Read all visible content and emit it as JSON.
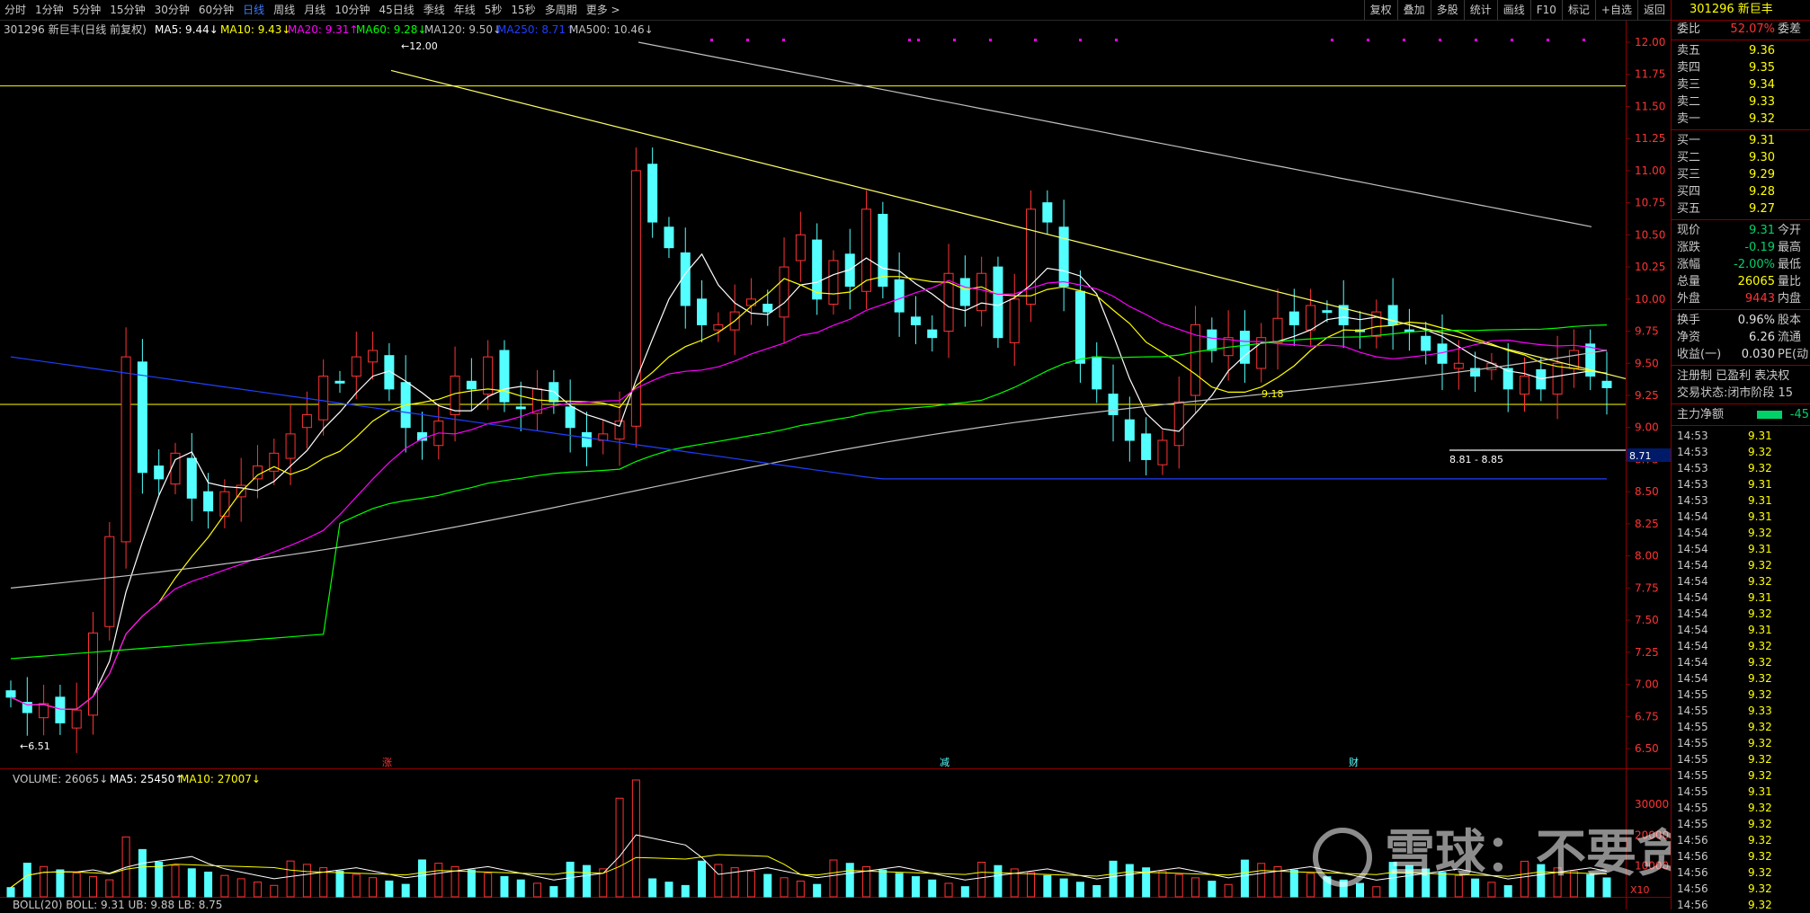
{
  "periods": [
    "分时",
    "1分钟",
    "5分钟",
    "15分钟",
    "30分钟",
    "60分钟",
    "日线",
    "周线",
    "月线",
    "10分钟",
    "45日线",
    "季线",
    "年线",
    "5秒",
    "15秒",
    "多周期",
    "更多 >"
  ],
  "active_period": "日线",
  "tools": [
    "复权",
    "叠加",
    "多股",
    "统计",
    "画线",
    "F10",
    "标记",
    "+自选",
    "返回"
  ],
  "chart_header": {
    "title": "301296 新巨丰(日线 前复权)",
    "ma5": "MA5: 9.44↓",
    "ma10": "MA10: 9.43↓",
    "ma20": "MA20: 9.31↑",
    "ma60": "MA60: 9.28↓",
    "ma120": "MA120: 9.50↓",
    "ma250": "MA250: 8.71↑",
    "ma500": "MA500: 10.46↓"
  },
  "volume_header": {
    "volume": "VOLUME: 26065↓",
    "ma5": "MA5: 25450↑",
    "ma10": "MA10: 27007↓"
  },
  "boll_header": "BOLL(20)  BOLL: 9.31  UB: 9.88  LB: 8.75",
  "annotations": {
    "high": "12.00",
    "low": "6.51",
    "mid_label": "9.18",
    "range": "8.81 - 8.85",
    "price_tag": "8.71",
    "vol_unit": "X10",
    "event1": "涨",
    "event2": "减",
    "event3": "财"
  },
  "price_axis": [
    "12.00",
    "11.75",
    "11.50",
    "11.25",
    "11.00",
    "10.75",
    "10.50",
    "10.25",
    "10.00",
    "9.75",
    "9.50",
    "9.25",
    "9.00",
    "8.75",
    "8.50",
    "8.25",
    "8.00",
    "7.75",
    "7.50",
    "7.25",
    "7.00",
    "6.75",
    "6.50"
  ],
  "vol_axis": [
    "30000",
    "20000",
    "10000"
  ],
  "sidebar": {
    "code": "301296",
    "name": "新巨丰",
    "weibi": {
      "label": "委比",
      "value": "52.07%",
      "extra": "委差"
    },
    "asks": [
      {
        "label": "卖五",
        "price": "9.36"
      },
      {
        "label": "卖四",
        "price": "9.35"
      },
      {
        "label": "卖三",
        "price": "9.34"
      },
      {
        "label": "卖二",
        "price": "9.33"
      },
      {
        "label": "卖一",
        "price": "9.32"
      }
    ],
    "bids": [
      {
        "label": "买一",
        "price": "9.31"
      },
      {
        "label": "买二",
        "price": "9.30"
      },
      {
        "label": "买三",
        "price": "9.29"
      },
      {
        "label": "买四",
        "price": "9.28"
      },
      {
        "label": "买五",
        "price": "9.27"
      }
    ],
    "quote": [
      {
        "label": "现价",
        "value": "9.31",
        "extra": "今开",
        "color": "green"
      },
      {
        "label": "涨跌",
        "value": "-0.19",
        "extra": "最高",
        "color": "green"
      },
      {
        "label": "涨幅",
        "value": "-2.00%",
        "extra": "最低",
        "color": "green"
      },
      {
        "label": "总量",
        "value": "26065",
        "extra": "量比",
        "color": "yellow"
      },
      {
        "label": "外盘",
        "value": "9443",
        "extra": "内盘",
        "color": "red"
      }
    ],
    "stats": [
      {
        "label": "换手",
        "value": "0.96%",
        "extra": "股本"
      },
      {
        "label": "净资",
        "value": "6.26",
        "extra": "流通"
      },
      {
        "label": "收益(一)",
        "value": "0.030",
        "extra": "PE(动"
      }
    ],
    "reg": "注册制 已盈利 表决权",
    "status": "交易状态:闭市阶段 15",
    "flow_label": "主力净额",
    "flow_value": "-45",
    "ticks": [
      {
        "t": "14:53",
        "p": "9.31",
        "c": "green"
      },
      {
        "t": "14:53",
        "p": "9.32",
        "c": "green"
      },
      {
        "t": "14:53",
        "p": "9.32",
        "c": "green"
      },
      {
        "t": "14:53",
        "p": "9.31",
        "c": "green"
      },
      {
        "t": "14:53",
        "p": "9.31",
        "c": "green"
      },
      {
        "t": "14:54",
        "p": "9.31",
        "c": "green"
      },
      {
        "t": "14:54",
        "p": "9.32",
        "c": "green"
      },
      {
        "t": "14:54",
        "p": "9.31",
        "c": "green"
      },
      {
        "t": "14:54",
        "p": "9.32",
        "c": "green"
      },
      {
        "t": "14:54",
        "p": "9.32",
        "c": "green"
      },
      {
        "t": "14:54",
        "p": "9.31",
        "c": "green"
      },
      {
        "t": "14:54",
        "p": "9.32",
        "c": "green"
      },
      {
        "t": "14:54",
        "p": "9.31",
        "c": "green"
      },
      {
        "t": "14:54",
        "p": "9.32",
        "c": "green"
      },
      {
        "t": "14:54",
        "p": "9.32",
        "c": "green"
      },
      {
        "t": "14:54",
        "p": "9.32",
        "c": "green"
      },
      {
        "t": "14:55",
        "p": "9.32",
        "c": "green"
      },
      {
        "t": "14:55",
        "p": "9.33",
        "c": "green"
      },
      {
        "t": "14:55",
        "p": "9.32",
        "c": "green"
      },
      {
        "t": "14:55",
        "p": "9.32",
        "c": "green"
      },
      {
        "t": "14:55",
        "p": "9.32",
        "c": "green"
      },
      {
        "t": "14:55",
        "p": "9.32",
        "c": "green"
      },
      {
        "t": "14:55",
        "p": "9.31",
        "c": "green"
      },
      {
        "t": "14:55",
        "p": "9.32",
        "c": "green"
      },
      {
        "t": "14:55",
        "p": "9.32",
        "c": "green"
      },
      {
        "t": "14:56",
        "p": "9.32",
        "c": "green"
      },
      {
        "t": "14:56",
        "p": "9.32",
        "c": "green"
      },
      {
        "t": "14:56",
        "p": "9.32",
        "c": "green"
      },
      {
        "t": "14:56",
        "p": "9.32",
        "c": "green"
      },
      {
        "t": "14:56",
        "p": "9.32",
        "c": "green"
      }
    ]
  },
  "watermark": "雪球：不要贪胜",
  "colors": {
    "up": "#ff3333",
    "down": "#54ffff",
    "ma5": "#ffffff",
    "ma10": "#ffff00",
    "ma20": "#ff00ff",
    "ma60": "#00ff00",
    "ma120": "#c0c0c0",
    "ma250": "#1f3fff",
    "ma500": "#c0c0c0"
  }
}
